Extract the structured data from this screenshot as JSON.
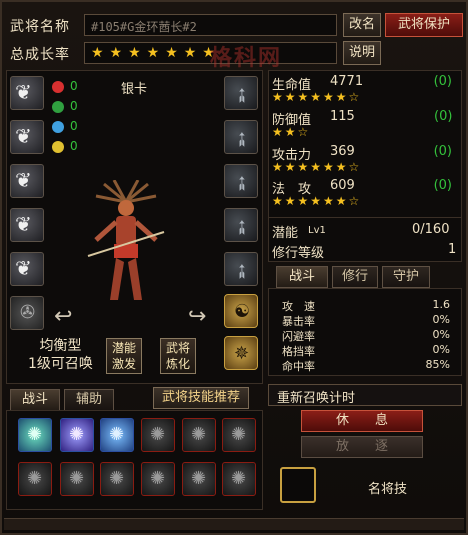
{
  "header": {
    "name_label": "武将名称",
    "name_value": "#105#G金环莤长#2",
    "growth_label": "总成长率",
    "growth_stars": "★★★★★★★",
    "watermark": "格科网",
    "rename_button": "改名",
    "protect_button": "武将保护",
    "help_button": "说明"
  },
  "left": {
    "rank_title": "银卡",
    "gems": [
      {
        "value": "0",
        "color": "#d83030"
      },
      {
        "value": "0",
        "color": "#30a040"
      },
      {
        "value": "0",
        "color": "#40a0e0"
      },
      {
        "value": "0",
        "color": "#e0c030"
      }
    ],
    "type_line1": "均衡型",
    "type_line2": "1级可召唤",
    "btn_potential": "潜能激发",
    "btn_fuse": "武将炼化"
  },
  "stats": {
    "rows": [
      {
        "name": "生命值",
        "value": "4771",
        "growth": "(0)",
        "stars": "★★★★★★☆"
      },
      {
        "name": "防御值",
        "value": "115",
        "growth": "(0)",
        "stars": "★★☆"
      },
      {
        "name": "攻击力",
        "value": "369",
        "growth": "(0)",
        "stars": "★★★★★★☆"
      },
      {
        "name": "法　攻",
        "value": "609",
        "growth": "(0)",
        "stars": "★★★★★★☆"
      }
    ],
    "potential_label": "潜能",
    "potential_level": "Lv1",
    "potential_value": "0/160",
    "cultivate_label": "修行等级",
    "cultivate_value": "1"
  },
  "right_tabs": [
    "战斗",
    "修行",
    "守护"
  ],
  "combat": [
    {
      "label": "攻　速",
      "value": "1.6"
    },
    {
      "label": "暴击率",
      "value": "0%"
    },
    {
      "label": "闪避率",
      "value": "0%"
    },
    {
      "label": "格挡率",
      "value": "0%"
    },
    {
      "label": "命中率",
      "value": "85%"
    }
  ],
  "summon_label": "重新召唤计时",
  "rest_button": "休　　息",
  "release_button": "放　　逐",
  "bottom_tabs": [
    "战斗",
    "辅助"
  ],
  "skill_recommend_button": "武将技能推荐",
  "fame_skill_label": "名将技"
}
